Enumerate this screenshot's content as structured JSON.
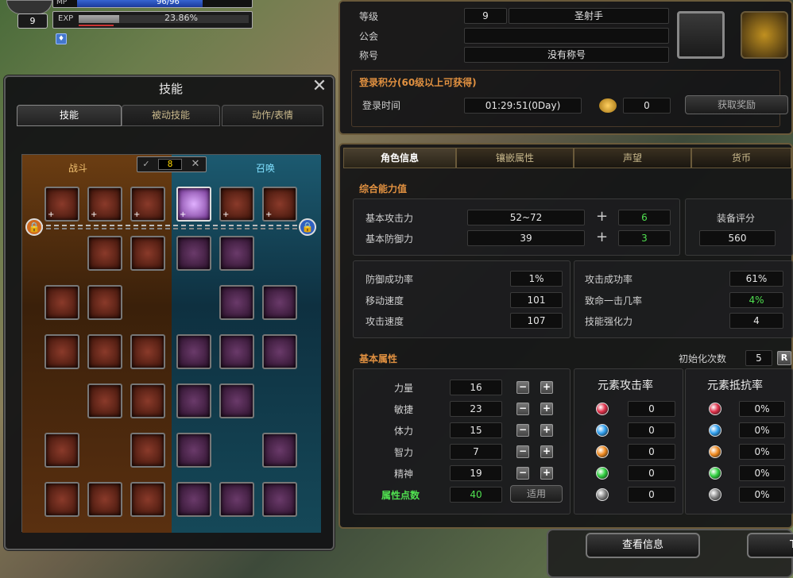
{
  "status": {
    "level": "9",
    "mp_label": "MP",
    "mp_value": "96/96",
    "mp_fill": 0.72,
    "exp_label": "EXP",
    "exp_value": "23.86%",
    "exp_fill": 0.2386
  },
  "skill_window": {
    "title": "技能",
    "close": "✕",
    "tabs": [
      "技能",
      "被动技能",
      "动作/表情"
    ],
    "fight_label": "战斗",
    "summon_label": "召唤",
    "counter_value": "8"
  },
  "char_info": {
    "level_label": "等级",
    "level_value": "9",
    "class_value": "圣射手",
    "guild_label": "公会",
    "guild_value": "",
    "title_label": "称号",
    "title_value": "没有称号",
    "login_section_title": "登录积分(60级以上可获得)",
    "login_time_label": "登录时间",
    "login_time_value": "01:29:51(0Day)",
    "login_points_value": "0",
    "claim_button": "获取奖励",
    "tabs": [
      "角色信息",
      "镶嵌属性",
      "声望",
      "货币"
    ],
    "combat_title": "综合能力值",
    "attack_label": "基本攻击力",
    "attack_value": "52~72",
    "attack_bonus": "6",
    "defense_label": "基本防御力",
    "defense_value": "39",
    "defense_bonus": "3",
    "equip_score_label": "装备评分",
    "equip_score_value": "560",
    "stats_left": [
      {
        "label": "防御成功率",
        "value": "1%"
      },
      {
        "label": "移动速度",
        "value": "101"
      },
      {
        "label": "攻击速度",
        "value": "107"
      }
    ],
    "stats_right": [
      {
        "label": "攻击成功率",
        "value": "61%"
      },
      {
        "label": "致命一击几率",
        "value": "4%"
      },
      {
        "label": "技能强化力",
        "value": "4"
      }
    ],
    "base_title": "基本属性",
    "reset_label": "初始化次数",
    "reset_value": "5",
    "reset_btn": "R",
    "base_stats": [
      {
        "label": "力量",
        "value": "16"
      },
      {
        "label": "敏捷",
        "value": "23"
      },
      {
        "label": "体力",
        "value": "15"
      },
      {
        "label": "智力",
        "value": "7"
      },
      {
        "label": "精神",
        "value": "19"
      }
    ],
    "points_label": "属性点数",
    "points_value": "40",
    "apply_button": "适用",
    "elem_attack_title": "元素攻击率",
    "elem_resist_title": "元素抵抗率",
    "elem_attack_values": [
      "0",
      "0",
      "0",
      "0",
      "0"
    ],
    "elem_resist_values": [
      "0%",
      "0%",
      "0%",
      "0%",
      "0%"
    ],
    "elem_colors": [
      "#e0304a",
      "#30a0f0",
      "#f08a20",
      "#30d040",
      "#888888"
    ]
  },
  "footer": {
    "view_button": "查看信息",
    "t_button": "T"
  }
}
